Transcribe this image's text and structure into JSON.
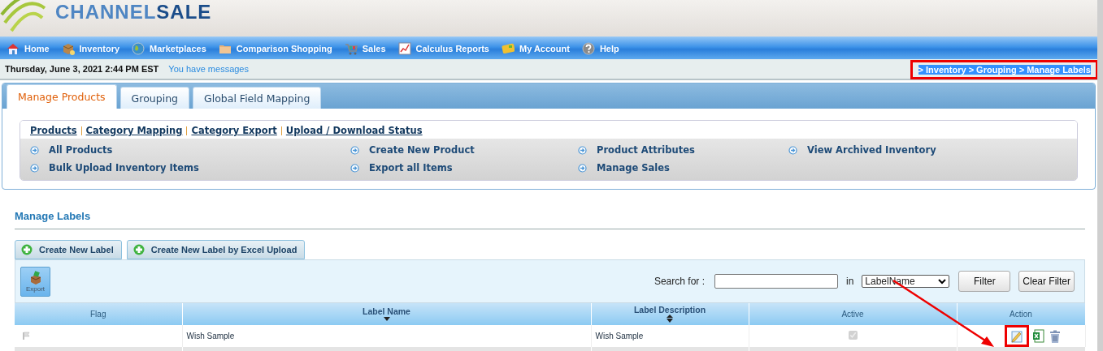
{
  "logo": {
    "part_1": "CHANNEL",
    "part_2": "SALE"
  },
  "nav": [
    {
      "label": "Home",
      "kind": "house"
    },
    {
      "label": "Inventory",
      "kind": "box"
    },
    {
      "label": "Marketplaces",
      "kind": "globe"
    },
    {
      "label": "Comparison Shopping",
      "kind": "folder"
    },
    {
      "label": "Sales",
      "kind": "cart"
    },
    {
      "label": "Calculus Reports",
      "kind": "chart"
    },
    {
      "label": "My Account",
      "kind": "card"
    },
    {
      "label": "Help",
      "kind": "help"
    }
  ],
  "status_bar": {
    "date": "Thursday, June 3, 2021 2:44 PM EST",
    "messages": "You have messages",
    "breadcrumb": "> Inventory > Grouping > Manage Labels",
    "breadcrumb_highlighted": true
  },
  "tabs": [
    {
      "label": "Manage Products",
      "selected": true
    },
    {
      "label": "Grouping",
      "selected": false
    },
    {
      "label": "Global Field Mapping",
      "selected": false
    }
  ],
  "sub_links": [
    "Products",
    "Category Mapping",
    "Category Export",
    "Upload / Download Status"
  ],
  "quick_links": [
    "All Products",
    "Create New Product",
    "Product Attributes",
    "View Archived Inventory",
    "Bulk Upload Inventory Items",
    "Export all Items",
    "Manage Sales"
  ],
  "section_title": "Manage Labels",
  "buttons": [
    "Create New Label",
    "Create New Label by Excel Upload"
  ],
  "toolbar": {
    "export": "Export",
    "search_label": "Search for :",
    "in_label": "in",
    "select_value": "LabelName",
    "filter": "Filter",
    "clear_filter": "Clear Filter"
  },
  "table": {
    "columns": [
      {
        "label": "Flag",
        "sort_up": false,
        "sort_down": false
      },
      {
        "label": "Label Name",
        "sort_up": false,
        "sort_down": true
      },
      {
        "label": "Label Description",
        "sort_up": true,
        "sort_down": true
      },
      {
        "label": "Active",
        "sort_up": false,
        "sort_down": false
      },
      {
        "label": "Action",
        "sort_up": false,
        "sort_down": false
      }
    ],
    "rows": [
      {
        "label_name": "Wish Sample",
        "label_description": "Wish Sample",
        "active": true,
        "edit_highlighted": true
      }
    ]
  }
}
